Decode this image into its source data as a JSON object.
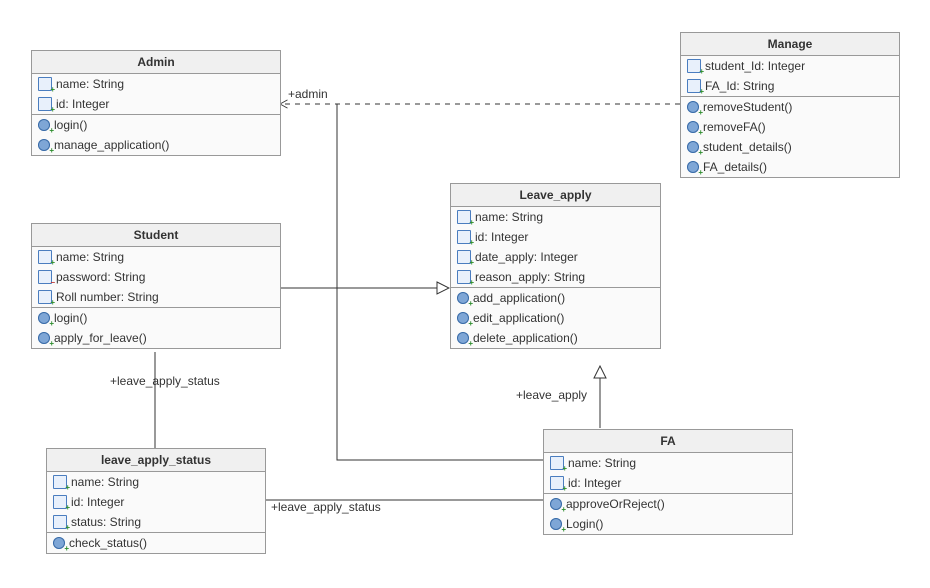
{
  "classes": {
    "admin": {
      "name": "Admin",
      "attrs": [
        "name: String",
        "id: Integer"
      ],
      "ops": [
        "login()",
        "manage_application()"
      ]
    },
    "student": {
      "name": "Student",
      "attrs": [
        "name: String",
        "password: String",
        "Roll number: String"
      ],
      "attr_vis": [
        "public",
        "private",
        "public"
      ],
      "ops": [
        "login()",
        "apply_for_leave()"
      ]
    },
    "leave_apply_status": {
      "name": "leave_apply_status",
      "attrs": [
        "name: String",
        "id: Integer",
        "status: String"
      ],
      "ops": [
        "check_status()"
      ]
    },
    "leave_apply": {
      "name": "Leave_apply",
      "attrs": [
        "name: String",
        "id: Integer",
        "date_apply: Integer",
        "reason_apply: String"
      ],
      "ops": [
        "add_application()",
        "edit_application()",
        "delete_application()"
      ]
    },
    "fa": {
      "name": "FA",
      "attrs": [
        "name: String",
        "id: Integer"
      ],
      "ops": [
        "approveOrReject()",
        "Login()"
      ]
    },
    "manage": {
      "name": "Manage",
      "attrs": [
        "student_Id: Integer",
        "FA_Id: String"
      ],
      "ops": [
        "removeStudent()",
        "removeFA()",
        "student_details()",
        "FA_details()"
      ]
    }
  },
  "labels": {
    "admin_assoc": "+admin",
    "leave_apply_status_assoc_top": "+leave_apply_status",
    "leave_apply_status_assoc_right": "+leave_apply_status",
    "leave_apply_assoc": "+leave_apply"
  },
  "relationships": [
    {
      "from": "Manage",
      "to": "Admin",
      "type": "dependency",
      "label": "+admin"
    },
    {
      "from": "Admin",
      "to": "Leave_apply",
      "type": "association"
    },
    {
      "from": "Student",
      "to": "Leave_apply",
      "type": "realization"
    },
    {
      "from": "Student",
      "to": "leave_apply_status",
      "type": "association",
      "label": "+leave_apply_status"
    },
    {
      "from": "leave_apply_status",
      "to": "FA",
      "type": "association",
      "label": "+leave_apply_status"
    },
    {
      "from": "FA",
      "to": "Leave_apply",
      "type": "generalization",
      "label": "+leave_apply"
    },
    {
      "from": "FA",
      "to": "Admin",
      "type": "association"
    }
  ]
}
